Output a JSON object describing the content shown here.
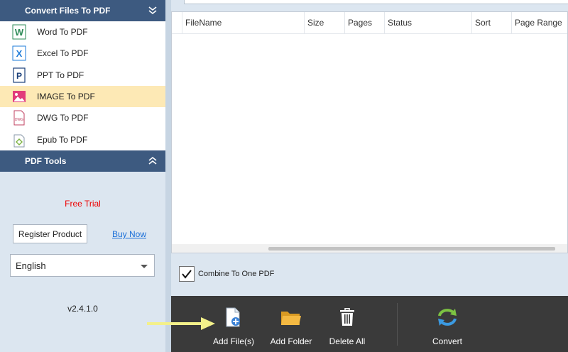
{
  "left_panel": {
    "convert_header": "Convert Files To PDF",
    "menu_items": [
      {
        "label": "Word To PDF",
        "icon": "word-icon",
        "active": false
      },
      {
        "label": "Excel To PDF",
        "icon": "excel-icon",
        "active": false
      },
      {
        "label": "PPT To PDF",
        "icon": "ppt-icon",
        "active": false
      },
      {
        "label": "IMAGE To PDF",
        "icon": "image-icon",
        "active": true
      },
      {
        "label": "DWG To PDF",
        "icon": "dwg-icon",
        "active": false
      },
      {
        "label": "Epub To PDF",
        "icon": "epub-icon",
        "active": false
      }
    ],
    "tools_header": "PDF Tools",
    "free_trial": "Free Trial",
    "register_button": "Register Product",
    "buy_now": "Buy Now",
    "language": "English",
    "version": "v2.4.1.0"
  },
  "table": {
    "columns": [
      "",
      "FileName",
      "Size",
      "Pages",
      "Status",
      "Sort",
      "Page Range"
    ],
    "rows": []
  },
  "combine_option": {
    "label": "Combine To One PDF",
    "checked": true
  },
  "toolbar": {
    "add_files": "Add File(s)",
    "add_folder": "Add Folder",
    "delete_all": "Delete All",
    "convert": "Convert"
  },
  "colors": {
    "section_header": "#3d5a80",
    "active_item": "#fde9b5",
    "toolbar_bg": "#3a3a3a",
    "free_trial": "#e00000",
    "link": "#1a6fd8",
    "arrow": "#f3f08a"
  }
}
